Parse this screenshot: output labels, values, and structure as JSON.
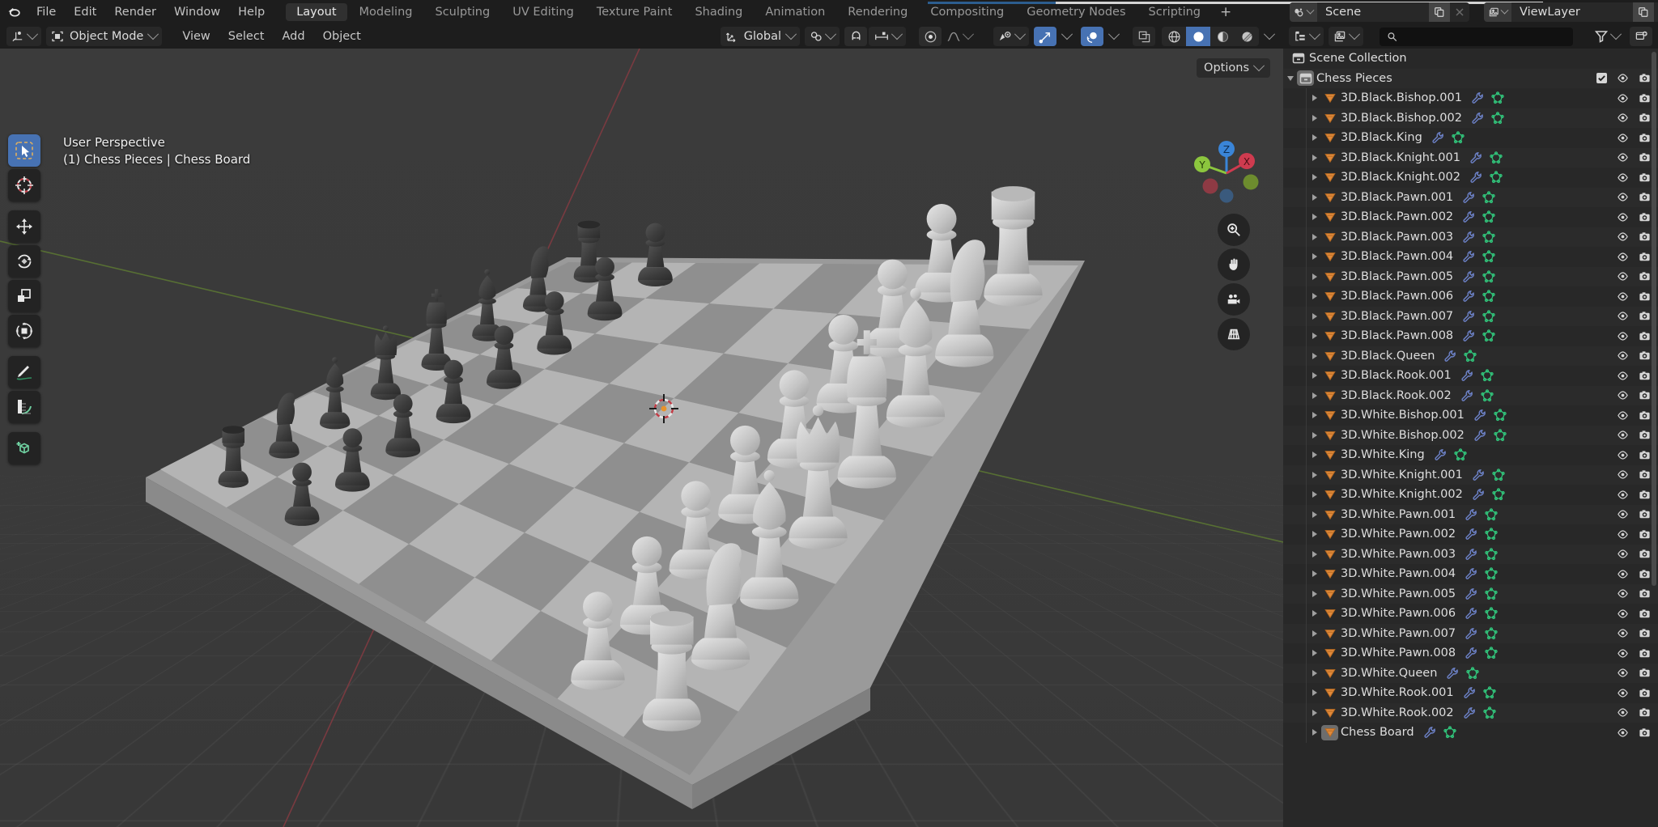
{
  "app": {
    "title": "Blender",
    "logo_icon": "blender-logo-icon"
  },
  "topbar": {
    "menus": [
      "File",
      "Edit",
      "Render",
      "Window",
      "Help"
    ],
    "workspace_tabs": [
      {
        "label": "Layout",
        "active": true
      },
      {
        "label": "Modeling",
        "active": false
      },
      {
        "label": "Sculpting",
        "active": false
      },
      {
        "label": "UV Editing",
        "active": false
      },
      {
        "label": "Texture Paint",
        "active": false
      },
      {
        "label": "Shading",
        "active": false
      },
      {
        "label": "Animation",
        "active": false
      },
      {
        "label": "Rendering",
        "active": false
      },
      {
        "label": "Compositing",
        "active": false
      },
      {
        "label": "Geometry Nodes",
        "active": false
      },
      {
        "label": "Scripting",
        "active": false
      }
    ],
    "add_workspace_label": "+",
    "scene": {
      "icon": "scene-icon",
      "name": "Scene",
      "new_copy_icon": "duplicate-icon",
      "unlink_icon": "close-icon"
    },
    "view_layer": {
      "icon": "view-layer-icon",
      "name": "ViewLayer",
      "new_copy_icon": "duplicate-icon",
      "unlink_icon": "close-icon"
    }
  },
  "viewport_header": {
    "editor_type_icon": "editor-type-3dview-icon",
    "mode": {
      "icon": "object-mode-icon",
      "label": "Object Mode"
    },
    "menus": [
      "View",
      "Select",
      "Add",
      "Object"
    ],
    "transform_orientation": {
      "icon": "orientation-icon",
      "label": "Global"
    },
    "snap": {
      "magnet_icon": "magnet-icon",
      "target_icon": "snap-target-icon"
    },
    "proportional": {
      "toggle_icon": "proportional-edit-icon",
      "falloff_icon": "falloff-curve-icon"
    },
    "right_controls": {
      "visibility_icon": "object-visibility-icon",
      "gizmo_icon": "gizmo-icon",
      "overlays_icon": "overlays-icon",
      "xray_icon": "xray-toggle-icon",
      "shading_modes": [
        {
          "name": "wireframe-shading-icon",
          "active": false
        },
        {
          "name": "solid-shading-icon",
          "active": true
        },
        {
          "name": "material-preview-shading-icon",
          "active": false
        },
        {
          "name": "rendered-shading-icon",
          "active": false
        }
      ]
    }
  },
  "viewport": {
    "options_label": "Options",
    "overlay_line1": "User Perspective",
    "overlay_line2": "(1) Chess Pieces | Chess Board",
    "gizmo_axes": [
      {
        "label": "Z",
        "color": "#3a85d8"
      },
      {
        "label": "Y",
        "color": "#8cc63e"
      },
      {
        "label": "X",
        "color": "#cf3b4f"
      }
    ],
    "nav_buttons": [
      "zoom-icon",
      "pan-hand-icon",
      "camera-view-icon",
      "toggle-perspective-icon"
    ],
    "cursor_icon": "3d-cursor-icon",
    "board": {
      "light_square_color": "#b4b4b4",
      "dark_square_color": "#8f8f8f",
      "black_piece_color": "#3e3e3e",
      "white_piece_color": "#cfcfcf"
    },
    "toolbar": [
      {
        "name": "tool-select-box",
        "icon": "cursor-arrow-icon",
        "active": true
      },
      {
        "name": "tool-cursor",
        "icon": "crosshair-icon",
        "active": false
      },
      {
        "name": "tool-move",
        "icon": "move-arrows-icon",
        "active": false
      },
      {
        "name": "tool-rotate",
        "icon": "rotate-icon",
        "active": false
      },
      {
        "name": "tool-scale",
        "icon": "scale-icon",
        "active": false
      },
      {
        "name": "tool-transform",
        "icon": "transform-icon",
        "active": false
      },
      {
        "name": "tool-annotate",
        "icon": "pencil-icon",
        "active": false
      },
      {
        "name": "tool-measure",
        "icon": "ruler-icon",
        "active": false
      },
      {
        "name": "tool-add-cube",
        "icon": "add-cube-icon",
        "active": false
      }
    ]
  },
  "outliner": {
    "display_mode_icon": "outliner-display-mode-icon",
    "id_type_icon": "id-type-filter-icon",
    "search_placeholder": "",
    "search_value": "",
    "search_icon": "search-icon",
    "filter_icon": "filter-funnel-icon",
    "new_collection_icon": "new-collection-icon",
    "scene_collection": {
      "icon": "collection-icon",
      "label": "Scene Collection"
    },
    "collection": {
      "icon": "collection-icon",
      "label": "Chess Pieces",
      "checkbox_checked": true,
      "hide_icon": "eye-icon",
      "render_icon": "camera-icon"
    },
    "column_icons": {
      "expand": "disclosure-triangle-icon",
      "object": "mesh-object-icon",
      "modifier": "wrench-modifier-icon",
      "mesh_data": "mesh-data-icon",
      "hide": "eye-icon",
      "render": "camera-icon"
    },
    "objects": [
      {
        "label": "3D.Black.Bishop.001",
        "selected": false
      },
      {
        "label": "3D.Black.Bishop.002",
        "selected": false
      },
      {
        "label": "3D.Black.King",
        "selected": false
      },
      {
        "label": "3D.Black.Knight.001",
        "selected": false
      },
      {
        "label": "3D.Black.Knight.002",
        "selected": false
      },
      {
        "label": "3D.Black.Pawn.001",
        "selected": false
      },
      {
        "label": "3D.Black.Pawn.002",
        "selected": false
      },
      {
        "label": "3D.Black.Pawn.003",
        "selected": false
      },
      {
        "label": "3D.Black.Pawn.004",
        "selected": false
      },
      {
        "label": "3D.Black.Pawn.005",
        "selected": false
      },
      {
        "label": "3D.Black.Pawn.006",
        "selected": false
      },
      {
        "label": "3D.Black.Pawn.007",
        "selected": false
      },
      {
        "label": "3D.Black.Pawn.008",
        "selected": false
      },
      {
        "label": "3D.Black.Queen",
        "selected": false
      },
      {
        "label": "3D.Black.Rook.001",
        "selected": false
      },
      {
        "label": "3D.Black.Rook.002",
        "selected": false
      },
      {
        "label": "3D.White.Bishop.001",
        "selected": false
      },
      {
        "label": "3D.White.Bishop.002",
        "selected": false
      },
      {
        "label": "3D.White.King",
        "selected": false
      },
      {
        "label": "3D.White.Knight.001",
        "selected": false
      },
      {
        "label": "3D.White.Knight.002",
        "selected": false
      },
      {
        "label": "3D.White.Pawn.001",
        "selected": false
      },
      {
        "label": "3D.White.Pawn.002",
        "selected": false
      },
      {
        "label": "3D.White.Pawn.003",
        "selected": false
      },
      {
        "label": "3D.White.Pawn.004",
        "selected": false
      },
      {
        "label": "3D.White.Pawn.005",
        "selected": false
      },
      {
        "label": "3D.White.Pawn.006",
        "selected": false
      },
      {
        "label": "3D.White.Pawn.007",
        "selected": false
      },
      {
        "label": "3D.White.Pawn.008",
        "selected": false
      },
      {
        "label": "3D.White.Queen",
        "selected": false
      },
      {
        "label": "3D.White.Rook.001",
        "selected": false
      },
      {
        "label": "3D.White.Rook.002",
        "selected": false
      },
      {
        "label": "Chess Board",
        "selected": true
      }
    ]
  },
  "colors": {
    "accent_blue": "#4772b3",
    "object_orange": "#e08a3c",
    "mesh_green": "#31c37a",
    "modifier_blue": "#6d82c8",
    "panel_bg": "#1d1d1d",
    "list_bg": "#282828"
  }
}
